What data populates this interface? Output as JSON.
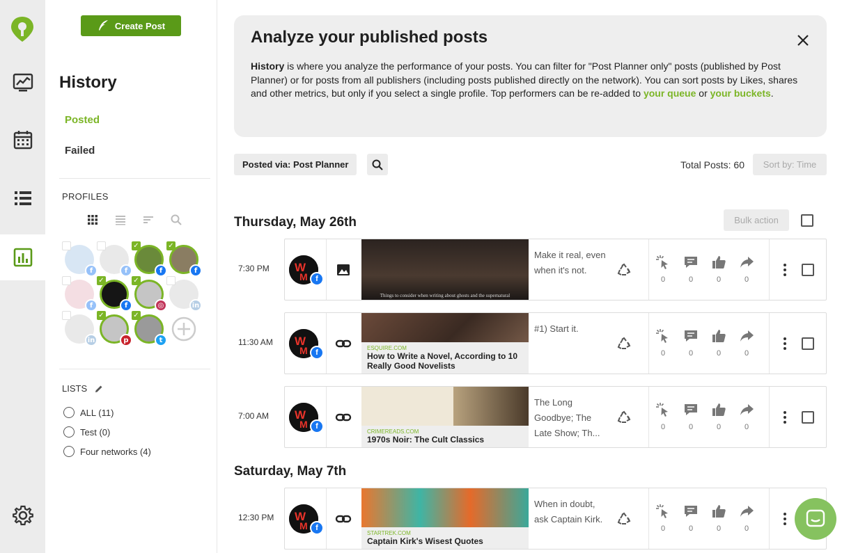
{
  "rail": {
    "items": [
      {
        "name": "dashboard-icon"
      },
      {
        "name": "calendar-icon"
      },
      {
        "name": "queue-list-icon"
      },
      {
        "name": "analytics-icon"
      },
      {
        "name": "gear-icon"
      }
    ]
  },
  "sidebar": {
    "create_label": "Create Post",
    "title": "History",
    "nav": {
      "posted": "Posted",
      "failed": "Failed"
    },
    "profiles_label": "PROFILES",
    "lists_label": "LISTS",
    "lists": [
      {
        "label": "ALL (11)"
      },
      {
        "label": "Test (0)"
      },
      {
        "label": "Four networks (4)"
      }
    ],
    "profiles": [
      {
        "network": "facebook",
        "selected": false,
        "color": "#a9c9e8"
      },
      {
        "network": "facebook",
        "selected": false,
        "color": "#cfcfcf"
      },
      {
        "network": "facebook",
        "selected": true,
        "color": "#6a8a3a"
      },
      {
        "network": "facebook",
        "selected": true,
        "color": "#8a7d62"
      },
      {
        "network": "facebook",
        "selected": false,
        "color": "#e7b7c2"
      },
      {
        "network": "facebook",
        "selected": true,
        "color": "#151515"
      },
      {
        "network": "instagram",
        "selected": true,
        "color": "#c5c5c5"
      },
      {
        "network": "linkedin",
        "selected": false,
        "color": "#d0d0d0"
      },
      {
        "network": "linkedin",
        "selected": false,
        "color": "#d0d0d0"
      },
      {
        "network": "pinterest",
        "selected": true,
        "color": "#c5c5c5"
      },
      {
        "network": "twitter",
        "selected": true,
        "color": "#9a9a9a"
      }
    ]
  },
  "info": {
    "title": "Analyze your published posts",
    "lead": "History",
    "body": " is where you analyze the performance of your posts. You can filter for \"Post Planner only\" posts (published by Post Planner) or for posts from all publishers (including posts published directly on the network). You can sort posts by Likes, shares and other metrics, but only if you select a single profile. Top performers can be re-added to ",
    "link1": "your queue",
    "or": " or ",
    "link2": "your buckets",
    "end": "."
  },
  "toolbar": {
    "filter_label": "Posted via: Post Planner",
    "total_label": "Total Posts: 60",
    "sort_label": "Sort by: Time",
    "bulk_label": "Bulk action"
  },
  "days": [
    {
      "title": "Thursday, May 26th"
    },
    {
      "title": "Saturday, May 7th"
    }
  ],
  "posts": [
    {
      "time": "7:30 PM",
      "type": "image",
      "source": "",
      "link_title": "",
      "thumb_caption": "Things to consider when writing about ghosts and the supernatural",
      "message": "Make it real, even when it's not.",
      "stats": [
        "0",
        "0",
        "0",
        "0"
      ]
    },
    {
      "time": "11:30 AM",
      "type": "link",
      "source": "ESQUIRE.COM",
      "link_title": "How to Write a Novel, According to 10 Really Good Novelists",
      "message": "#1) Start it.",
      "stats": [
        "0",
        "0",
        "0",
        "0"
      ]
    },
    {
      "time": "7:00 AM",
      "type": "link",
      "source": "CRIMEREADS.COM",
      "link_title": "1970s Noir: The Cult Classics",
      "message": "The Long Goodbye; The Late Show; Th...",
      "stats": [
        "0",
        "0",
        "0",
        "0"
      ]
    },
    {
      "time": "12:30 PM",
      "type": "link",
      "source": "STARTREK.COM",
      "link_title": "Captain Kirk's Wisest Quotes",
      "message": "When in doubt, ask Captain Kirk.",
      "stats": [
        "0",
        "0",
        "0",
        "0"
      ]
    }
  ],
  "colors": {
    "accent": "#7bb526",
    "button": "#5a9a18",
    "facebook": "#1877f2"
  }
}
